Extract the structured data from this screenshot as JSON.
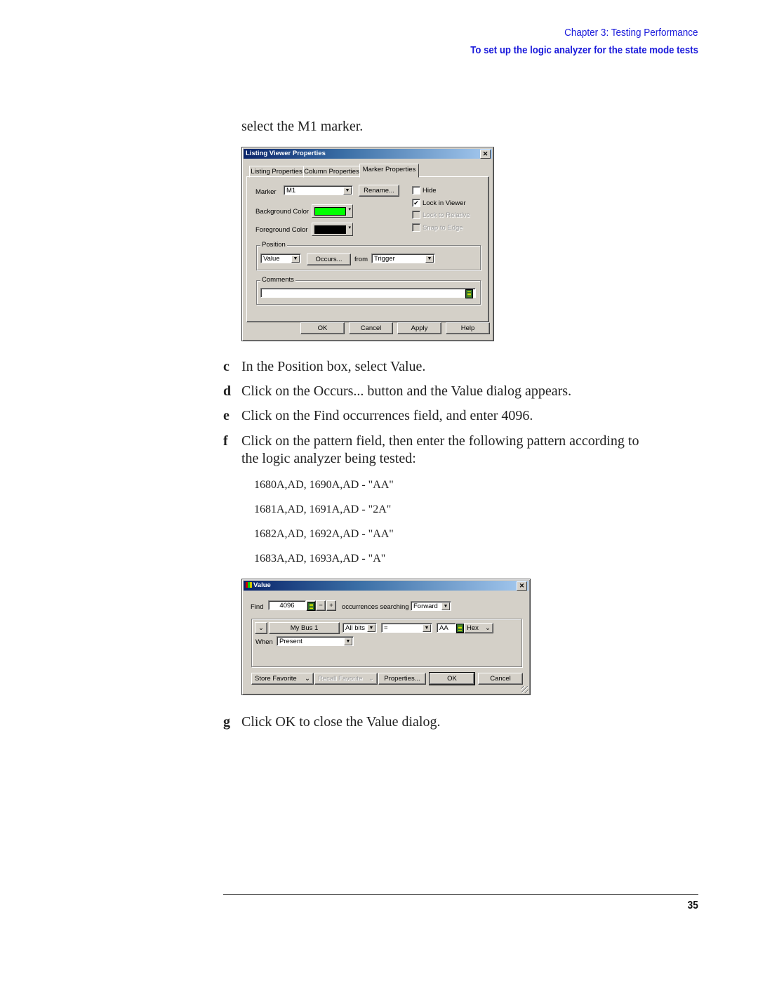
{
  "header": {
    "chapter": "Chapter 3: Testing Performance",
    "section": "To set up the logic analyzer for the state mode tests"
  },
  "intro_text": "select the M1 marker.",
  "listing_dialog": {
    "title": "Listing Viewer Properties",
    "tabs": [
      "Listing Properties",
      "Column Properties",
      "Marker Properties"
    ],
    "active_tab": "Marker Properties",
    "marker_label": "Marker",
    "marker_value": "M1",
    "rename_label": "Rename...",
    "bg_color_label": "Background Color",
    "bg_color": "#00ff00",
    "fg_color_label": "Foreground Color",
    "fg_color": "#000000",
    "checkboxes": [
      {
        "label": "Hide",
        "checked": false,
        "enabled": true
      },
      {
        "label": "Lock in Viewer",
        "checked": true,
        "enabled": true
      },
      {
        "label": "Lock to Relative",
        "checked": false,
        "enabled": false
      },
      {
        "label": "Snap to Edge",
        "checked": false,
        "enabled": false
      }
    ],
    "position_group": "Position",
    "position_value": "Value",
    "occurs_label": "Occurs...",
    "from_label": "from",
    "from_value": "Trigger",
    "comments_group": "Comments",
    "comments_value": "",
    "buttons": [
      "OK",
      "Cancel",
      "Apply",
      "Help"
    ]
  },
  "steps": [
    {
      "letter": "c",
      "text": "In the Position box, select Value."
    },
    {
      "letter": "d",
      "text": "Click on the Occurs... button and the Value dialog appears."
    },
    {
      "letter": "e",
      "text": "Click on the Find occurrences field, and enter 4096."
    },
    {
      "letter": "f",
      "text": "Click on the pattern field, then enter the following pattern according to",
      "text2": "the logic analyzer being tested:"
    },
    {
      "letter": "g",
      "text": "Click OK to close the Value dialog."
    }
  ],
  "patterns": [
    "1680A,AD, 1690A,AD - \"AA\"",
    "1681A,AD, 1691A,AD - \"2A\"",
    "1682A,AD, 1692A,AD - \"AA\"",
    "1683A,AD, 1693A,AD - \"A\""
  ],
  "value_dialog": {
    "title": "Value",
    "find_label": "Find",
    "find_value": "4096",
    "minus": "−",
    "plus": "+",
    "occurrences_label": "occurrences searching",
    "direction_value": "Forward",
    "expand_glyph": "¥",
    "bus_label": "My Bus 1",
    "bits_value": "All bits",
    "operator_value": "=",
    "pattern_value": "AA",
    "base_value": "Hex",
    "when_label": "When",
    "when_value": "Present",
    "buttons": {
      "store_favorite": "Store Favorite",
      "recall_favorite": "Recall Favorite",
      "properties": "Properties...",
      "ok": "OK",
      "cancel": "Cancel"
    }
  },
  "footer": {
    "page_number": "35"
  }
}
